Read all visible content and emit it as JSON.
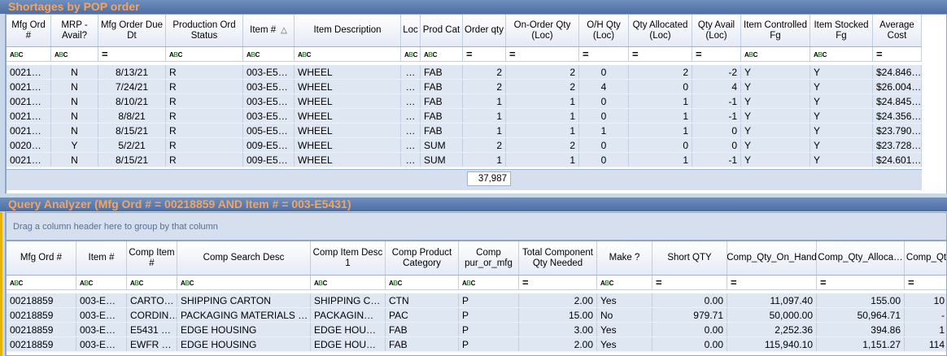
{
  "panel1": {
    "title": "Shortages by POP order",
    "columns": [
      {
        "label": "Mfg Ord #",
        "filter": "abc"
      },
      {
        "label": "MRP - Avail?",
        "filter": "abc"
      },
      {
        "label": "Mfg Order Due Dt",
        "filter": "eq"
      },
      {
        "label": "Production Ord Status",
        "filter": "abc"
      },
      {
        "label": "Item #",
        "filter": "abc",
        "sorted": "asc"
      },
      {
        "label": "Item Description",
        "filter": "abc"
      },
      {
        "label": "Loc",
        "filter": "abc"
      },
      {
        "label": "Prod Cat",
        "filter": "abc"
      },
      {
        "label": "Order qty",
        "filter": "eq"
      },
      {
        "label": "On-Order Qty (Loc)",
        "filter": "eq"
      },
      {
        "label": "O/H Qty (Loc)",
        "filter": "eq"
      },
      {
        "label": "Qty Allocated (Loc)",
        "filter": "eq"
      },
      {
        "label": "Qty Avail (Loc)",
        "filter": "eq"
      },
      {
        "label": "Item Controlled Fg",
        "filter": "abc"
      },
      {
        "label": "Item Stocked Fg",
        "filter": "abc"
      },
      {
        "label": "Average Cost",
        "filter": "eq"
      }
    ],
    "rows": [
      [
        "0021…",
        "N",
        "8/13/21",
        "R",
        "003-E5…",
        "WHEEL",
        "…",
        "FAB",
        "2",
        "2",
        "0",
        "2",
        "-2",
        "Y",
        "Y",
        "$24.846…"
      ],
      [
        "0021…",
        "N",
        "7/24/21",
        "R",
        "003-E5…",
        "WHEEL",
        "…",
        "FAB",
        "2",
        "2",
        "4",
        "0",
        "4",
        "Y",
        "Y",
        "$26.004…"
      ],
      [
        "0021…",
        "N",
        "8/10/21",
        "R",
        "003-E5…",
        "WHEEL",
        "…",
        "FAB",
        "1",
        "1",
        "0",
        "1",
        "-1",
        "Y",
        "Y",
        "$24.845…"
      ],
      [
        "0021…",
        "N",
        "8/8/21",
        "R",
        "003-E5…",
        "WHEEL",
        "…",
        "FAB",
        "1",
        "1",
        "0",
        "1",
        "-1",
        "Y",
        "Y",
        "$24.356…"
      ],
      [
        "0021…",
        "N",
        "8/15/21",
        "R",
        "005-E5…",
        "WHEEL",
        "…",
        "FAB",
        "1",
        "1",
        "1",
        "1",
        "0",
        "Y",
        "Y",
        "$23.790…"
      ],
      [
        "0020…",
        "Y",
        "5/2/21",
        "R",
        "009-E5…",
        "WHEEL",
        "…",
        "SUM",
        "2",
        "2",
        "0",
        "0",
        "0",
        "Y",
        "Y",
        "$23.728…"
      ],
      [
        "0021…",
        "N",
        "8/15/21",
        "R",
        "009-E5…",
        "WHEEL",
        "…",
        "SUM",
        "1",
        "1",
        "0",
        "1",
        "-1",
        "Y",
        "Y",
        "$24.601…"
      ]
    ],
    "summary_value": "37,987"
  },
  "panel2": {
    "title": "Query Analyzer (Mfg Ord # = 00218859 AND Item # = 003-E5431)",
    "group_hint": "Drag a column header here to group by that column",
    "columns": [
      {
        "label": "Mfg Ord #",
        "filter": "abc"
      },
      {
        "label": "Item #",
        "filter": "abc"
      },
      {
        "label": "Comp Item #",
        "filter": "abc"
      },
      {
        "label": "Comp Search Desc",
        "filter": "abc"
      },
      {
        "label": "Comp Item Desc 1",
        "filter": "abc"
      },
      {
        "label": "Comp Product Category",
        "filter": "abc"
      },
      {
        "label": "Comp pur_or_mfg",
        "filter": "abc"
      },
      {
        "label": "Total Component Qty Needed",
        "filter": "eq"
      },
      {
        "label": "Make ?",
        "filter": "abc"
      },
      {
        "label": "Short QTY",
        "filter": "eq"
      },
      {
        "label": "Comp_Qty_On_Hand",
        "filter": "eq"
      },
      {
        "label": "Comp_Qty_Alloca…",
        "filter": "eq"
      },
      {
        "label": "Comp_Qt",
        "filter": "eq"
      }
    ],
    "rows": [
      [
        "00218859",
        "003-E…",
        "CARTO…",
        "SHIPPING CARTON",
        "SHIPPING C…",
        "CTN",
        "P",
        "2.00",
        "Yes",
        "0.00",
        "11,097.40",
        "155.00",
        "10"
      ],
      [
        "00218859",
        "003-E…",
        "CORDIN…",
        "PACKAGING MATERIALS …",
        "PACKAGIN…",
        "PAC",
        "P",
        "15.00",
        "No",
        "979.71",
        "50,000.00",
        "50,964.71",
        "-"
      ],
      [
        "00218859",
        "003-E…",
        "E5431 …",
        "EDGE HOUSING",
        "EDGE HOU…",
        "FAB",
        "P",
        "3.00",
        "Yes",
        "0.00",
        "2,252.36",
        "394.86",
        "1"
      ],
      [
        "00218859",
        "003-E…",
        "EWFR …",
        "EDGE HOUSING",
        "EDGE HOU…",
        "FAB",
        "P",
        "2.00",
        "Yes",
        "0.00",
        "115,940.10",
        "1,151.27",
        "114"
      ]
    ]
  }
}
